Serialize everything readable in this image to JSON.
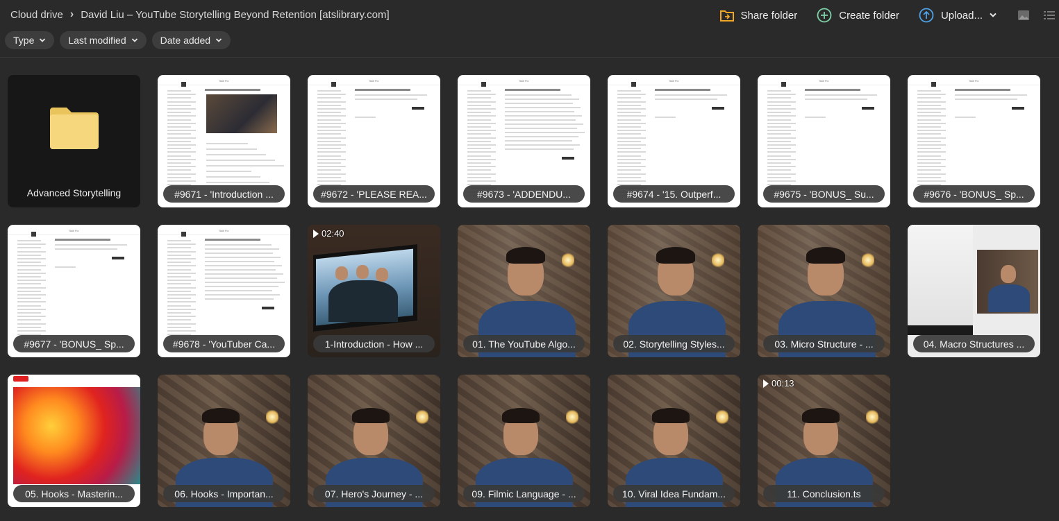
{
  "breadcrumb": {
    "root": "Cloud drive",
    "current": "David Liu – YouTube Storytelling Beyond Retention [atslibrary.com]"
  },
  "actions": {
    "share": "Share folder",
    "create": "Create folder",
    "upload": "Upload..."
  },
  "filters": {
    "type": "Type",
    "last_modified": "Last modified",
    "date_added": "Date added"
  },
  "icons": {
    "share": "share-folder-icon",
    "create": "plus-circle-icon",
    "upload": "upload-arrow-icon",
    "thumbnail_view": "image-icon",
    "list_view": "list-icon"
  },
  "colors": {
    "share_icon": "#f5a623",
    "create_icon": "#7fd3a8",
    "upload_icon": "#4fa3e8",
    "folder": "#f7d77e"
  },
  "items": [
    {
      "type": "folder",
      "name": "Advanced Storytelling"
    },
    {
      "type": "doc",
      "name": "#9671 - 'Introduction ...",
      "variant": "image"
    },
    {
      "type": "doc",
      "name": "#9672 - 'PLEASE REA...",
      "variant": "plain"
    },
    {
      "type": "doc",
      "name": "#9673 - 'ADDENDU...",
      "variant": "text"
    },
    {
      "type": "doc",
      "name": "#9674 - '15. Outperf...",
      "variant": "plain"
    },
    {
      "type": "doc",
      "name": "#9675 - 'BONUS_ Su...",
      "variant": "plain"
    },
    {
      "type": "doc",
      "name": "#9676 - 'BONUS_ Sp...",
      "variant": "plain"
    },
    {
      "type": "doc",
      "name": "#9677 - 'BONUS_ Sp...",
      "variant": "plain"
    },
    {
      "type": "doc",
      "name": "#9678 - 'YouTuber Ca...",
      "variant": "text"
    },
    {
      "type": "video",
      "name": "1-Introduction - How ...",
      "duration": "02:40",
      "scene": "beach"
    },
    {
      "type": "video",
      "name": "01. The YouTube Algo...",
      "scene": "person"
    },
    {
      "type": "video",
      "name": "02. Storytelling Styles...",
      "scene": "person"
    },
    {
      "type": "video",
      "name": "03. Micro Structure - ...",
      "scene": "person"
    },
    {
      "type": "video",
      "name": "04. Macro Structures ...",
      "scene": "split"
    },
    {
      "type": "video",
      "name": "05. Hooks - Masterin...",
      "scene": "paint"
    },
    {
      "type": "video",
      "name": "06. Hooks - Importan...",
      "scene": "person2"
    },
    {
      "type": "video",
      "name": "07. Hero's Journey - ...",
      "scene": "person2"
    },
    {
      "type": "video",
      "name": "09. Filmic Language - ...",
      "scene": "person2"
    },
    {
      "type": "video",
      "name": "10. Viral Idea Fundam...",
      "scene": "person2"
    },
    {
      "type": "video",
      "name": "11. Conclusion.ts",
      "duration": "00:13",
      "scene": "person2"
    }
  ]
}
